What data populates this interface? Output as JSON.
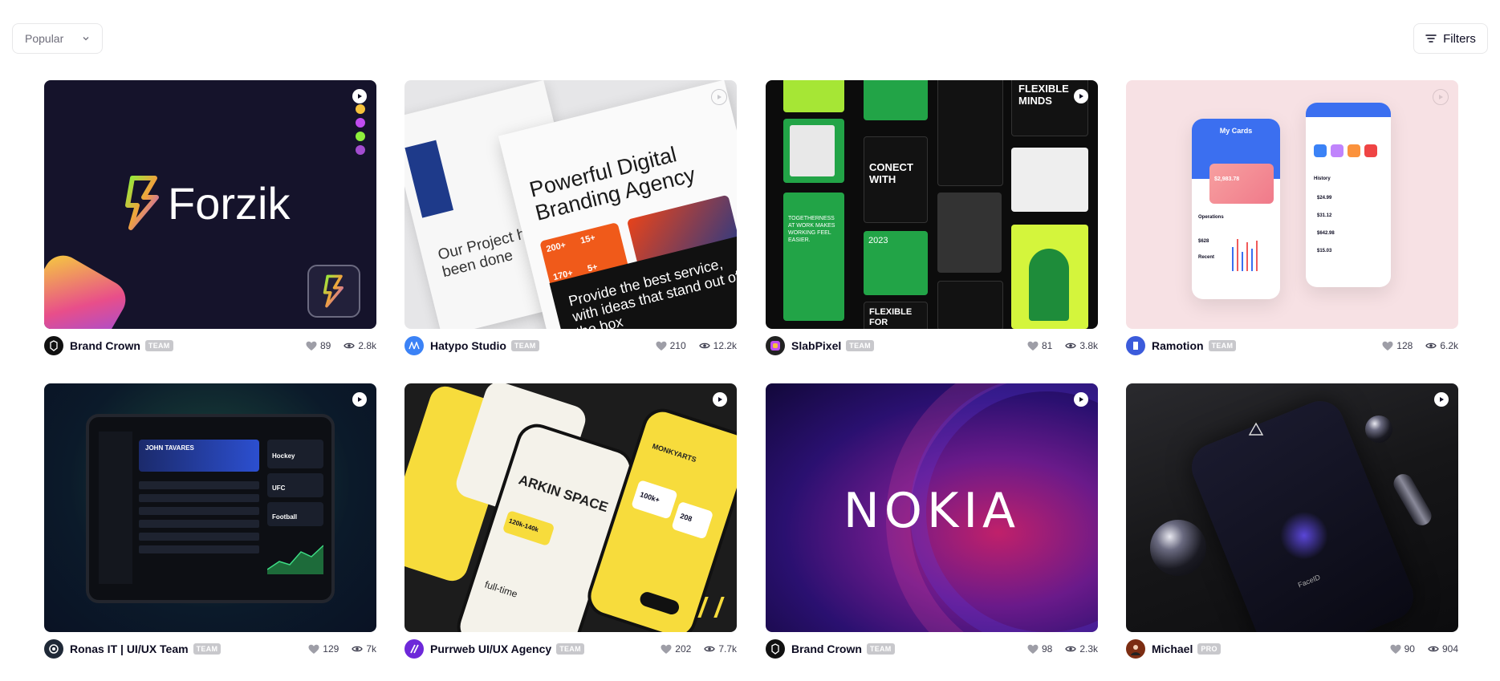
{
  "toolbar": {
    "sort_value": "Popular",
    "filters_label": "Filters"
  },
  "shots": [
    {
      "title_art": "Forzik",
      "author": "Brand Crown",
      "tag": "TEAM",
      "likes": "89",
      "views": "2.8k"
    },
    {
      "title_art": "Powerful Digital Branding Agency",
      "art_sub1": "Our Project have been done",
      "art_sub2": "Provide the best service, with ideas that stand out of the box",
      "art_stats": [
        "200+",
        "15+",
        "170+",
        "5+"
      ],
      "author": "Hatypo Studio",
      "tag": "TEAM",
      "likes": "210",
      "views": "12.2k"
    },
    {
      "title_art": "FLEXIBLE MINDS",
      "art_lines": [
        "CONECT WITH",
        "2023",
        "FLEXIBLE FOR FLEXIBLE MINDS",
        "TOGETHERNESS AT WORK MAKES WORKING FEEL EASIER."
      ],
      "author": "SlabPixel",
      "tag": "TEAM",
      "likes": "81",
      "views": "3.8k"
    },
    {
      "title_art": "My Cards",
      "art_lines": [
        "$2,983.78",
        "Operations",
        "History",
        "$24.99",
        "$31.12",
        "$642.98",
        "$15.03",
        "$1,298",
        "$628",
        "Recent"
      ],
      "author": "Ramotion",
      "tag": "TEAM",
      "likes": "128",
      "views": "6.2k"
    },
    {
      "title_art": "JOHN TAVARES",
      "art_lines": [
        "Hockey",
        "UFC",
        "Football"
      ],
      "author": "Ronas IT | UI/UX Team",
      "tag": "TEAM",
      "likes": "129",
      "views": "7k"
    },
    {
      "title_art": "ARKIN SPACE",
      "art_lines": [
        "120k-140k",
        "full-time",
        "100k+",
        "208",
        "MONKYARTS"
      ],
      "author": "Purrweb UI/UX Agency",
      "tag": "TEAM",
      "likes": "202",
      "views": "7.7k"
    },
    {
      "title_art": "NOKIA",
      "author": "Brand Crown",
      "tag": "TEAM",
      "likes": "98",
      "views": "2.3k"
    },
    {
      "title_art": "FaceID",
      "author": "Michael",
      "tag": "PRO",
      "likes": "90",
      "views": "904"
    }
  ],
  "colors": {
    "accent": "#0d0c22",
    "muted": "#6e6d7a",
    "tag_bg": "#c8c8cc"
  }
}
